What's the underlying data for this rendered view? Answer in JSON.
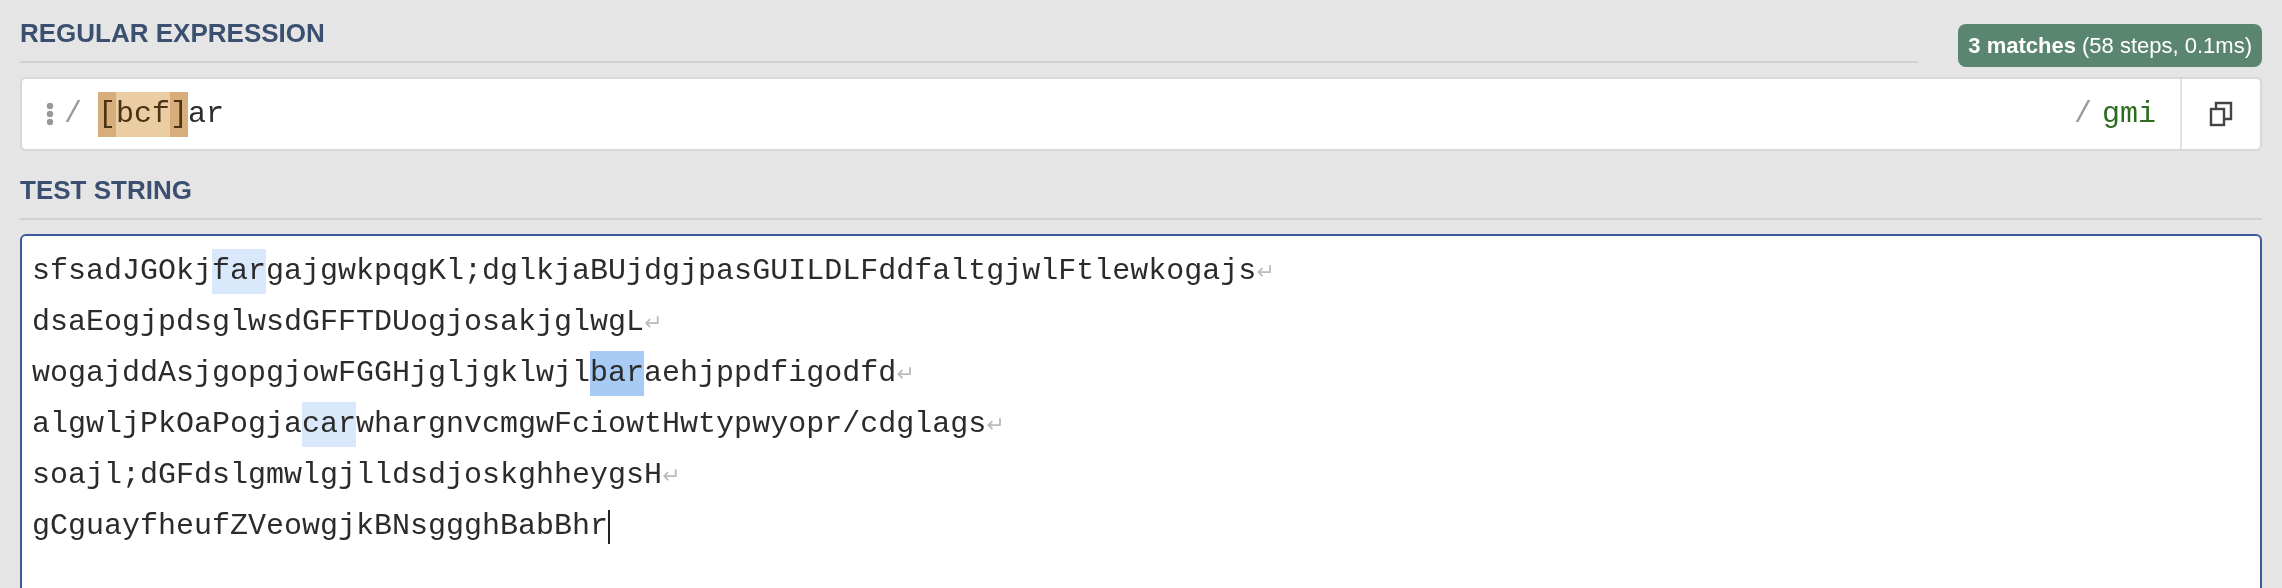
{
  "regex_section": {
    "heading": "REGULAR EXPRESSION",
    "match_info": {
      "count": "3 matches",
      "details": "(58 steps, 0.1ms)"
    },
    "open_delimiter": "/",
    "tokens": [
      {
        "kind": "bracket",
        "text": "["
      },
      {
        "kind": "class",
        "text": "bcf"
      },
      {
        "kind": "bracket",
        "text": "]"
      },
      {
        "kind": "plain",
        "text": "ar"
      }
    ],
    "close_delimiter": "/",
    "flags": "gmi"
  },
  "test_section": {
    "heading": "TEST STRING",
    "lines": [
      {
        "segments": [
          {
            "kind": "text",
            "text": "sfsadJGOkj"
          },
          {
            "kind": "match",
            "text": "far",
            "selected": false
          },
          {
            "kind": "text",
            "text": "gajgwkpqgKl;dglkjaBUjdgjpasGUILDLFddfaltgjwlFtlewkogajs"
          }
        ],
        "eol": "↵"
      },
      {
        "segments": [
          {
            "kind": "text",
            "text": "dsaEogjpdsglwsdGFFTDUogjosakjglwgL"
          }
        ],
        "eol": "↵"
      },
      {
        "segments": [
          {
            "kind": "text",
            "text": "wogajddAsjgopgjowFGGHjgljgklwjl"
          },
          {
            "kind": "match",
            "text": "bar",
            "selected": true
          },
          {
            "kind": "text",
            "text": "aehjppdfigodfd"
          }
        ],
        "eol": "↵"
      },
      {
        "segments": [
          {
            "kind": "text",
            "text": "algwljPkOaPogja"
          },
          {
            "kind": "match",
            "text": "car",
            "selected": false
          },
          {
            "kind": "text",
            "text": "whargnvcmgwFciowtHwtypwyopr/cdglags"
          }
        ],
        "eol": "↵"
      },
      {
        "segments": [
          {
            "kind": "text",
            "text": "soajl;dGFdslgmwlgjlldsdjoskghheygsH"
          }
        ],
        "eol": "↵"
      },
      {
        "segments": [
          {
            "kind": "text",
            "text": "gCguayfheufZVeowgjkBNsggghBabBhr"
          }
        ],
        "cursor": true
      }
    ]
  }
}
